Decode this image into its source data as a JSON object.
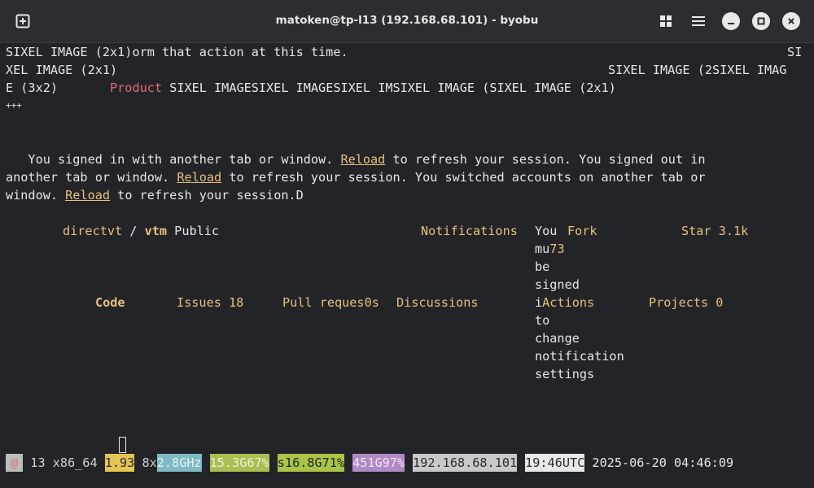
{
  "window": {
    "title": "matoken@tp-l13 (192.168.68.101) - byobu",
    "new_tab_icon": "plus-square-icon",
    "grid_icon": "grid-icon",
    "menu_icon": "hamburger-icon",
    "minimize_icon": "minimize-icon",
    "maximize_icon": "maximize-icon",
    "close_icon": "close-icon"
  },
  "terminal": {
    "line1_a": "SIXEL IMAGE (2x1)orm that action at this time.",
    "line1_b": "SI",
    "line2_a": "XEL IMAGE (2x1)",
    "line2_b": "SIXEL IMAGE (2SIXEL IMAG",
    "line3_a": "E (3x2)       ",
    "line3_product": "Product",
    "line3_b": " SIXEL IMAGESIXEL IMAGESIXEL IMSIXEL IMAGE (SIXEL IMAGE (2x1)",
    "line4": "+++",
    "line5_a": "   You signed in with another tab or window. ",
    "reload": "Reload",
    "line5_b": " to refresh your session. You signed out in",
    "line6_a": "another tab or window. ",
    "line6_b": " to refresh your session. You switched accounts on another tab or",
    "line7_a": "window. ",
    "line7_b": " to refresh your session.D",
    "owner": "directvt",
    "sep": " / ",
    "repo": "vtm",
    "visibility": " Public",
    "notifications": "Notifications",
    "popup": [
      "You",
      "mu",
      "be",
      "signed",
      "i",
      "to",
      "change",
      "notification",
      "settings"
    ],
    "fork": "Fork",
    "fork_count": "73",
    "star": "Star",
    "star_count": "3.1k",
    "code": "Code",
    "issues": "Issues 18",
    "pulls": "Pull reques0s",
    "discussions": "Discussions",
    "actions": "Actions",
    "projects": "Projects 0"
  },
  "statusbar": {
    "logo": "@",
    "count": " 13",
    "arch": " x86_64 ",
    "load": "1.93",
    "cpus": " 8x",
    "freq": "2.8GHz",
    "mem": "15.3G67%",
    "swap": "s16.8G71%",
    "disk": "451G97%",
    "ip": "192.168.68.101",
    "time_utc": "19:46UTC",
    "datetime": " 2025-06-20 04:46:09"
  },
  "colors": {
    "accent_yellow": "#e6c07b",
    "accent_red": "#e06c75",
    "status_load_bg": "#e5c453",
    "status_freq_bg": "#7fb9c4",
    "status_mem_bg": "#a8bf52",
    "status_swap_bg": "#a9c446",
    "status_disk_bg": "#b18ac5",
    "status_ip_bg": "#c9c9c9",
    "status_time_bg": "#e8e8e8"
  }
}
